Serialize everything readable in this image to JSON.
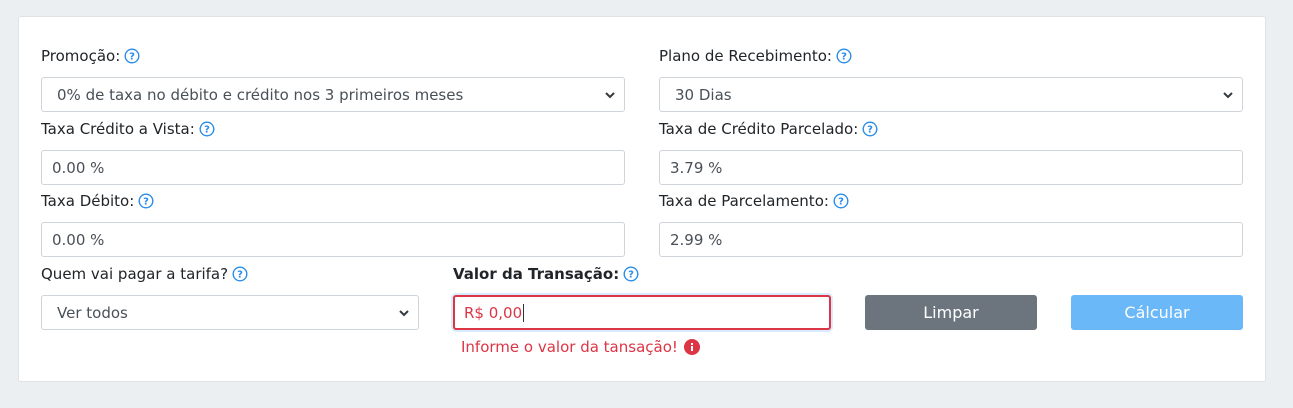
{
  "form": {
    "promocao": {
      "label": "Promoção:",
      "value": "0% de taxa no débito e crédito nos 3 primeiros meses"
    },
    "plano": {
      "label": "Plano de Recebimento:",
      "value": "30 Dias"
    },
    "credito_vista": {
      "label": "Taxa Crédito a Vista:",
      "value": "0.00 %"
    },
    "credito_parcelado": {
      "label": "Taxa de Crédito Parcelado:",
      "value": "3.79 %"
    },
    "debito": {
      "label": "Taxa Débito:",
      "value": "0.00 %"
    },
    "parcelamento": {
      "label": "Taxa de Parcelamento:",
      "value": "2.99 %"
    },
    "quem_paga": {
      "label": "Quem vai pagar a tarifa?",
      "value": "Ver todos"
    },
    "valor": {
      "label": "Valor da Transação:",
      "value": "R$ 0,00",
      "error": "Informe o valor da tansação!"
    }
  },
  "buttons": {
    "clear": "Limpar",
    "calc": "Cálcular"
  },
  "colors": {
    "help": "#2b8de8",
    "error": "#dc3545",
    "clear_btn": "#6c757d",
    "calc_btn": "#6ab8f7"
  }
}
